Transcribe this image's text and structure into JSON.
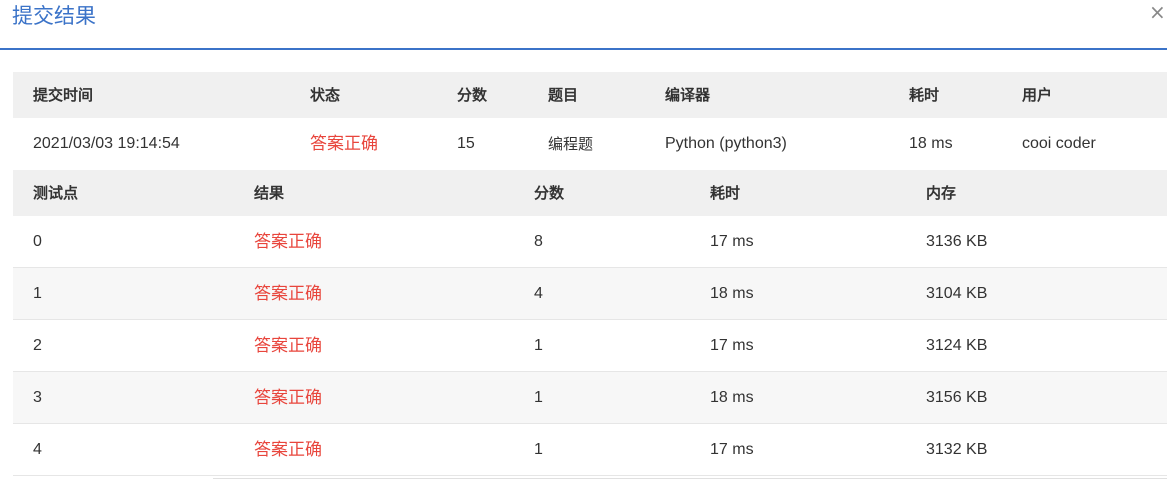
{
  "modal": {
    "title": "提交结果",
    "close_label": "×"
  },
  "submission": {
    "headers": {
      "time": "提交时间",
      "status": "状态",
      "score": "分数",
      "problem": "题目",
      "compiler": "编译器",
      "duration": "耗时",
      "user": "用户"
    },
    "row": {
      "time": "2021/03/03 19:14:54",
      "status": "答案正确",
      "score": "15",
      "problem": "编程题",
      "compiler": "Python (python3)",
      "duration": "18 ms",
      "user": "cooi coder"
    }
  },
  "testcases": {
    "headers": {
      "id": "测试点",
      "result": "结果",
      "score": "分数",
      "duration": "耗时",
      "memory": "内存"
    },
    "rows": [
      {
        "id": "0",
        "result": "答案正确",
        "score": "8",
        "duration": "17 ms",
        "memory": "3136 KB"
      },
      {
        "id": "1",
        "result": "答案正确",
        "score": "4",
        "duration": "18 ms",
        "memory": "3104 KB"
      },
      {
        "id": "2",
        "result": "答案正确",
        "score": "1",
        "duration": "17 ms",
        "memory": "3124 KB"
      },
      {
        "id": "3",
        "result": "答案正确",
        "score": "1",
        "duration": "18 ms",
        "memory": "3156 KB"
      },
      {
        "id": "4",
        "result": "答案正确",
        "score": "1",
        "duration": "17 ms",
        "memory": "3132 KB"
      }
    ]
  },
  "colors": {
    "accent": "#3b73c8",
    "status_correct": "#e8453c",
    "header_bg": "#f0f0f0",
    "alt_row_bg": "#f7f7f7"
  }
}
